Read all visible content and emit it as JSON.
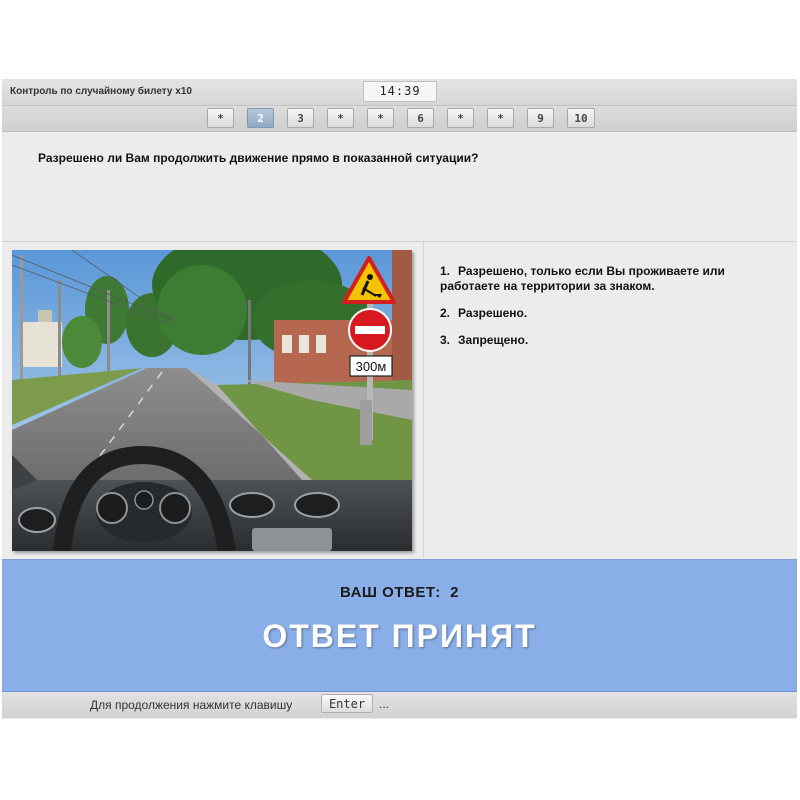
{
  "header": {
    "exam_title": "Контроль по случайному билету x10",
    "timer": "14:39"
  },
  "question_nav": {
    "current": 2,
    "items": [
      {
        "label": "*",
        "state": "answered"
      },
      {
        "label": "2",
        "state": "current"
      },
      {
        "label": "3",
        "state": "unanswered"
      },
      {
        "label": "*",
        "state": "answered"
      },
      {
        "label": "*",
        "state": "answered"
      },
      {
        "label": "6",
        "state": "unanswered"
      },
      {
        "label": "*",
        "state": "answered"
      },
      {
        "label": "*",
        "state": "answered"
      },
      {
        "label": "9",
        "state": "unanswered"
      },
      {
        "label": "10",
        "state": "unanswered"
      }
    ]
  },
  "question": {
    "text": "Разрешено ли Вам продолжить движение прямо в показанной ситуации?",
    "image": {
      "sign_distance_plate": "300м",
      "icons": [
        "road-works-sign-icon",
        "no-entry-sign-icon"
      ]
    }
  },
  "answers": [
    {
      "number": "1.",
      "text": "Разрешено, только если Вы проживаете или работаете на территории за знаком."
    },
    {
      "number": "2.",
      "text": "Разрешено."
    },
    {
      "number": "3.",
      "text": "Запрещено."
    }
  ],
  "result": {
    "your_answer": "ВАШ ОТВЕТ:  2",
    "status": "ОТВЕТ ПРИНЯТ"
  },
  "footer": {
    "prompt": "Для продолжения нажмите клавишу",
    "key": "Enter",
    "ellipsis": "..."
  },
  "colors": {
    "result_bg": "#8aaee8",
    "current_question_bg": "#9ab2cc",
    "no_entry_red": "#d7191f",
    "warning_yellow": "#f5c400"
  }
}
